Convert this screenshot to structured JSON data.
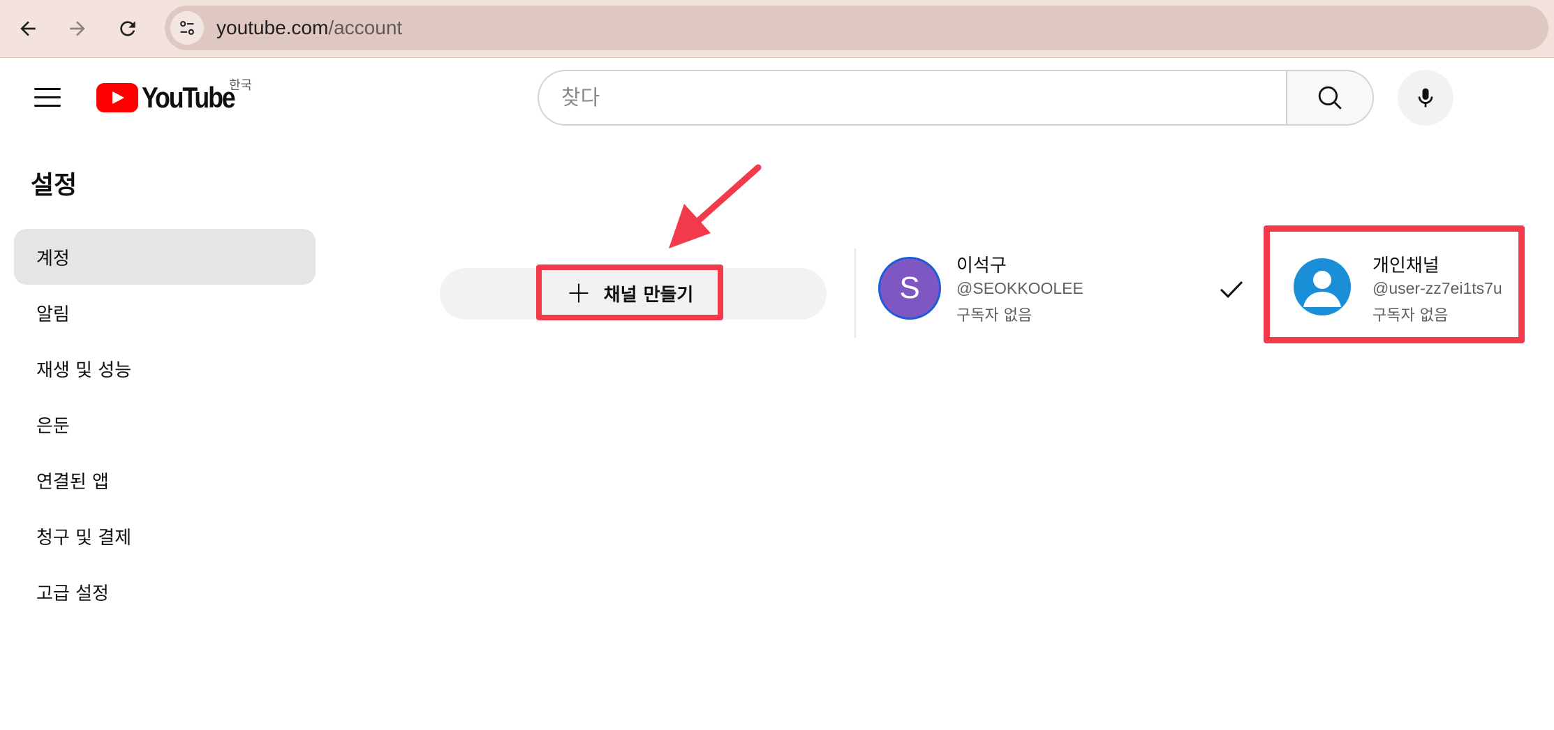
{
  "browser": {
    "url_host": "youtube.com",
    "url_path": "/account"
  },
  "header": {
    "logo_text": "YouTube",
    "region": "한국",
    "search_placeholder": "찾다"
  },
  "sidebar": {
    "title": "설정",
    "items": [
      {
        "label": "계정",
        "active": true
      },
      {
        "label": "알림"
      },
      {
        "label": "재생 및 성능"
      },
      {
        "label": "은둔"
      },
      {
        "label": "연결된 앱"
      },
      {
        "label": "청구 및 결제"
      },
      {
        "label": "고급 설정"
      }
    ]
  },
  "main": {
    "create_channel_label": "채널 만들기",
    "channels": [
      {
        "name": "이석구",
        "handle": "@SEOKKOOLEE",
        "subscribers": "구독자 없음",
        "avatar_letter": "S",
        "selected": true
      },
      {
        "name": "개인채널",
        "handle": "@user-zz7ei1ts7u",
        "subscribers": "구독자 없음"
      }
    ]
  },
  "colors": {
    "highlight": "#f23a4b",
    "youtube_red": "#ff0000",
    "avatar_purple": "#7e57c2",
    "avatar_blue": "#1a8fd8"
  }
}
